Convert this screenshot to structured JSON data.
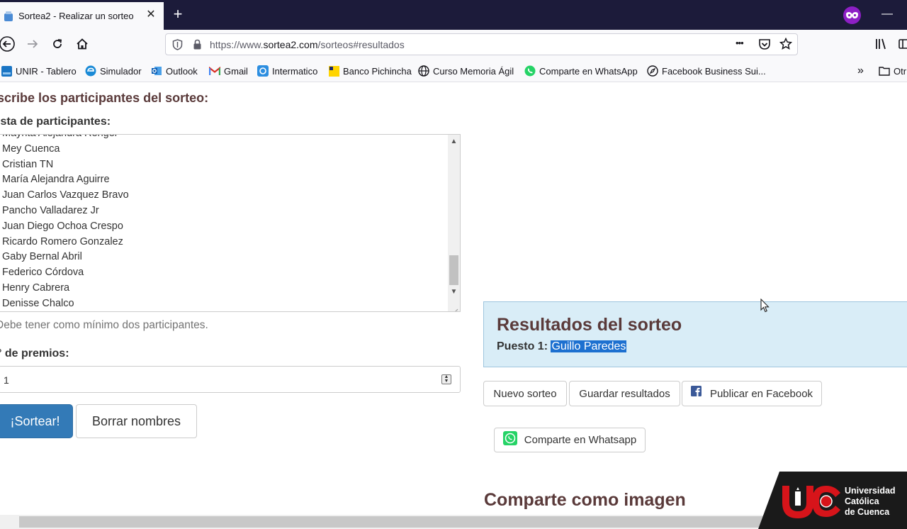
{
  "browser": {
    "tab_title": "Sortea2 - Realizar un sorteo",
    "tab_close": "✕",
    "new_tab": "+",
    "minimize": "—",
    "url_prefix": "https://www.",
    "url_host": "sortea2.com",
    "url_path": "/sorteos#resultados",
    "more_dots": "•••"
  },
  "bookmarks": [
    {
      "label": "UNIR - Tablero",
      "icon": "unir-icon"
    },
    {
      "label": "Simulador",
      "icon": "edge-icon"
    },
    {
      "label": "Outlook",
      "icon": "outlook-icon"
    },
    {
      "label": "Gmail",
      "icon": "gmail-icon"
    },
    {
      "label": "Intermatico",
      "icon": "intermatico-icon"
    },
    {
      "label": "Banco Pichincha",
      "icon": "bank-icon"
    },
    {
      "label": "Curso Memoria Ágil",
      "icon": "globe-icon"
    },
    {
      "label": "Comparte en WhatsApp",
      "icon": "whatsapp-icon"
    },
    {
      "label": "Facebook Business Sui...",
      "icon": "compass-icon"
    }
  ],
  "bookmarks_other": "Otr",
  "form": {
    "heading": "scribe los participantes del sorteo:",
    "list_label": "ista de participantes:",
    "participants": [
      "Mayrita Alejandra Renger",
      "Mey Cuenca",
      "Cristian TN",
      "María Alejandra Aguirre",
      "Juan Carlos Vazquez Bravo",
      "Pancho Valladarez Jr",
      "Juan Diego Ochoa Crespo",
      "Ricardo Romero Gonzalez",
      "Gaby Bernal Abril",
      "Federico Córdova",
      "Henry Cabrera",
      "Denisse Chalco"
    ],
    "help": "Debe tener como mínimo dos participantes.",
    "prizes_label": "° de premios:",
    "prizes_value": "1",
    "draw_button": "¡Sortear!",
    "clear_button": "Borrar nombres"
  },
  "results": {
    "title": "Resultados del sorteo",
    "place_label": "Puesto 1:",
    "winner": "Guillo Paredes",
    "new_draw": "Nuevo sorteo",
    "save": "Guardar resultados",
    "facebook": "Publicar en Facebook",
    "whatsapp": "Comparte en Whatsapp",
    "share_image_title": "Comparte como imagen"
  },
  "logo": {
    "line1": "Universidad",
    "line2": "Católica",
    "line3": "de Cuenca"
  },
  "colors": {
    "primary": "#337ab7",
    "result_bg": "#d9edf7",
    "result_title": "#5a3a3a",
    "tabbar": "#1c1b3a",
    "private": "#8d1fc5"
  }
}
